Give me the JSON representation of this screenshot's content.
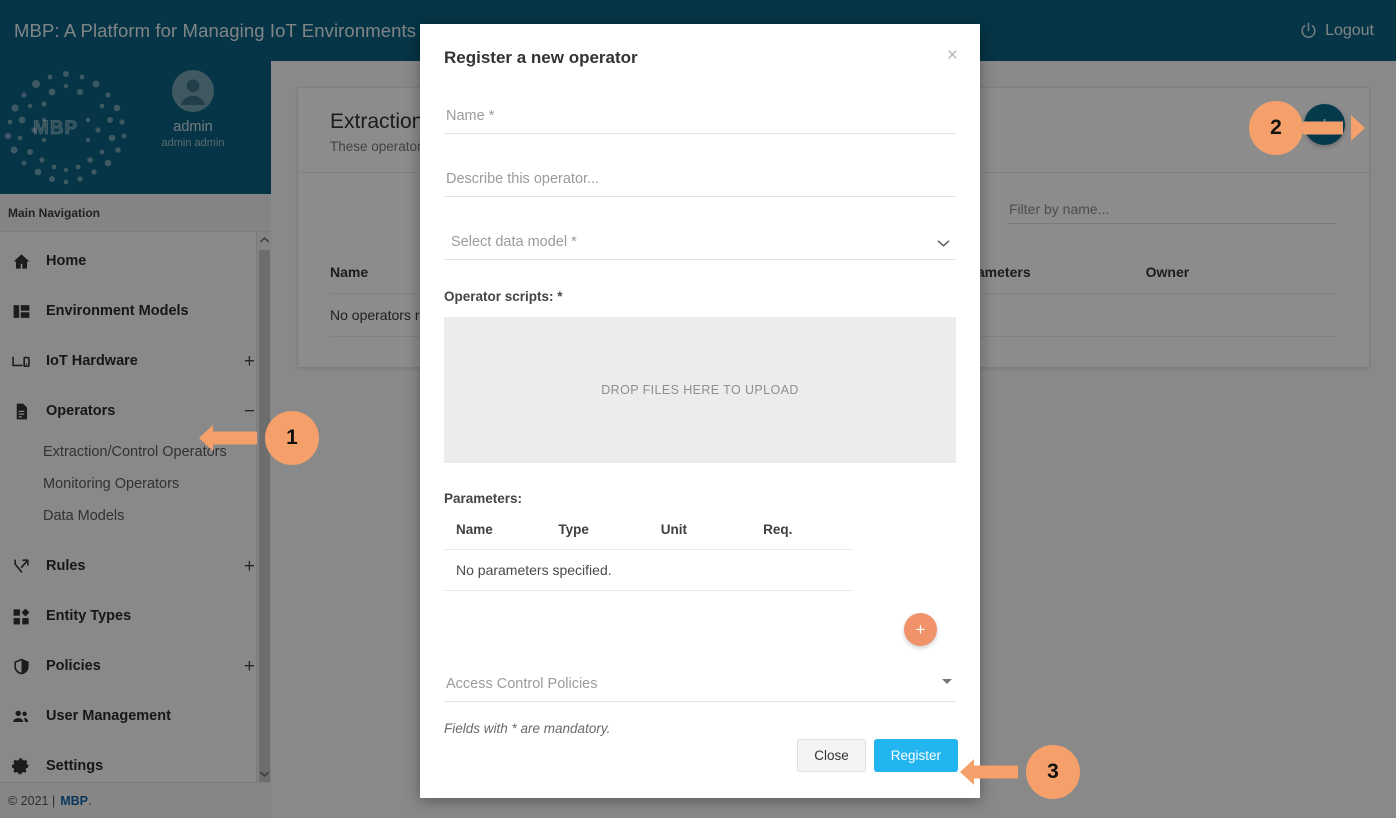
{
  "header": {
    "title": "MBP: A Platform for Managing IoT Environments",
    "logout_label": "Logout",
    "logout_icon": "power-icon",
    "bg_color": "#0a6180"
  },
  "sidebar": {
    "logo_word": "MBP",
    "profile": {
      "name": "admin",
      "subtitle": "admin admin",
      "avatar_icon": "account-circle-icon"
    },
    "nav_heading": "Main Navigation",
    "items": [
      {
        "label": "Home",
        "icon": "home-icon",
        "expander": ""
      },
      {
        "label": "Environment Models",
        "icon": "dashboard-icon",
        "expander": ""
      },
      {
        "label": "IoT Hardware",
        "icon": "devices-icon",
        "expander": "+"
      },
      {
        "label": "Operators",
        "icon": "document-icon",
        "expander": "−"
      },
      {
        "label": "Rules",
        "icon": "branch-icon",
        "expander": "+"
      },
      {
        "label": "Entity Types",
        "icon": "shapes-icon",
        "expander": ""
      },
      {
        "label": "Policies",
        "icon": "shield-icon",
        "expander": "+"
      },
      {
        "label": "User Management",
        "icon": "people-icon",
        "expander": ""
      },
      {
        "label": "Settings",
        "icon": "gear-icon",
        "expander": ""
      }
    ],
    "operators_subitems": [
      {
        "label": "Extraction/Control Operators"
      },
      {
        "label": "Monitoring Operators"
      },
      {
        "label": "Data Models"
      }
    ],
    "scroll_up_icon": "chevron-up-icon",
    "scroll_down_icon": "chevron-down-icon"
  },
  "footer": {
    "copyright": "© 2021 |",
    "link_label": "MBP",
    "period": "."
  },
  "main": {
    "card_title": "Extraction/Control Operators",
    "card_subtitle": "These operators e",
    "add_button_label": "+",
    "filter_placeholder": "Filter by name...",
    "filter_value": "",
    "table": {
      "columns": [
        "Name",
        "Parameters",
        "Owner"
      ],
      "empty_message": "No operators reg"
    }
  },
  "modal": {
    "title": "Register a new operator",
    "close_icon": "close-icon",
    "name_placeholder": "Name *",
    "name_value": "",
    "description_placeholder": "Describe this operator...",
    "description_value": "",
    "data_model_placeholder": "Select data model *",
    "data_model_value": "",
    "scripts_label": "Operator scripts: *",
    "dropzone_text": "DROP FILES HERE TO UPLOAD",
    "parameters_label": "Parameters:",
    "parameters_columns": [
      "Name",
      "Type",
      "Unit",
      "Req."
    ],
    "parameters_empty": "No parameters specified.",
    "add_parameter_label": "+",
    "access_control_placeholder": "Access Control Policies",
    "access_control_value": "",
    "mandatory_note": "Fields with * are mandatory.",
    "close_label": "Close",
    "register_label": "Register",
    "register_color": "#22b5f0"
  },
  "annotations": {
    "accent_color": "#f5a06a",
    "steps": [
      {
        "number": "1"
      },
      {
        "number": "2"
      },
      {
        "number": "3"
      }
    ]
  }
}
